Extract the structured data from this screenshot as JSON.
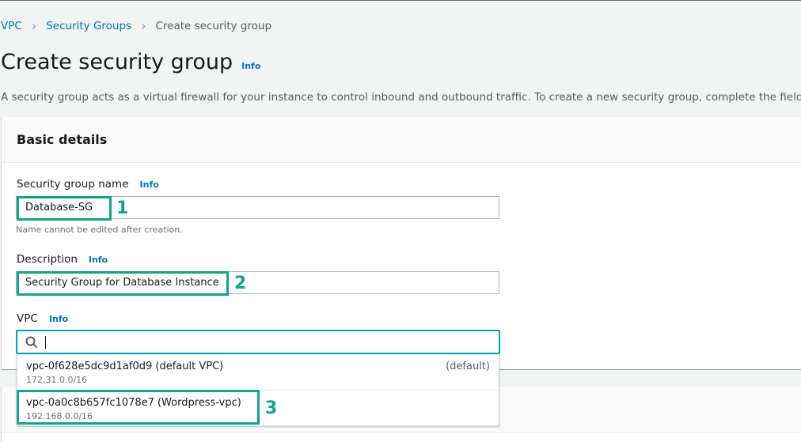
{
  "breadcrumb": {
    "items": [
      {
        "label": "VPC"
      },
      {
        "label": "Security Groups"
      }
    ],
    "current": "Create security group"
  },
  "page": {
    "title": "Create security group",
    "info": "Info",
    "description": "A security group acts as a virtual firewall for your instance to control inbound and outbound traffic. To create a new security group, complete the fields below."
  },
  "basic_details": {
    "heading": "Basic details",
    "name_field": {
      "label": "Security group name",
      "info": "Info",
      "value": "Database-SG",
      "constraint": "Name cannot be edited after creation."
    },
    "description_field": {
      "label": "Description",
      "info": "Info",
      "value": "Security Group for Database Instance"
    },
    "vpc_field": {
      "label": "VPC",
      "info": "Info",
      "search_value": "",
      "search_icon": "search-icon",
      "options": [
        {
          "label": "vpc-0f628e5dc9d1af0d9 (default VPC)",
          "cidr": "172.31.0.0/16",
          "tag": "(default)"
        },
        {
          "label": "vpc-0a0c8b657fc1078e7 (Wordpress-vpc)",
          "cidr": "192.168.0.0/16",
          "tag": ""
        }
      ]
    }
  },
  "annotations": {
    "color": "#0fa68a",
    "steps": [
      "1",
      "2",
      "3"
    ]
  }
}
